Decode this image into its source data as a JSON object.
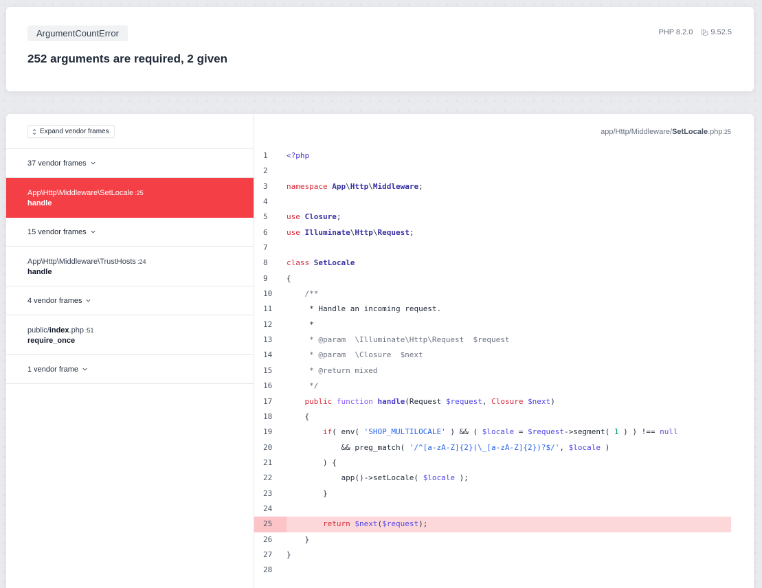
{
  "header": {
    "exception_class": "ArgumentCountError",
    "message": "252 arguments are required, 2 given",
    "php_version": "PHP 8.2.0",
    "laravel_version": "9.52.5"
  },
  "frames": {
    "expand_label": "Expand vendor frames",
    "groups": [
      {
        "vendor_label": "37 vendor frames"
      },
      {
        "path_prefix": "App\\Http\\Middleware\\SetLocale",
        "line": ":25",
        "method": "handle"
      },
      {
        "vendor_label": "15 vendor frames"
      },
      {
        "path_prefix": "App\\Http\\Middleware\\TrustHosts",
        "line": ":24",
        "method": "handle"
      },
      {
        "vendor_label": "4 vendor frames"
      },
      {
        "path_prefix": "public/",
        "path_bold": "index",
        "path_suffix": ".php",
        "line": ":51",
        "method": "require_once"
      },
      {
        "vendor_label": "1 vendor frame"
      }
    ]
  },
  "code_pane": {
    "path_prefix": "app/Http/Middleware/",
    "path_bold": "SetLocale",
    "path_suffix": ".php",
    "line": ":25",
    "highlighted_line": 25
  },
  "icons": {
    "expand": "chevron-up-down-icon",
    "vendor_toggle": "chevron-down-icon",
    "laravel": "laravel-logo-icon"
  },
  "colors": {
    "active_frame": "#f43f46",
    "highlight_line": "#fdd8da"
  }
}
